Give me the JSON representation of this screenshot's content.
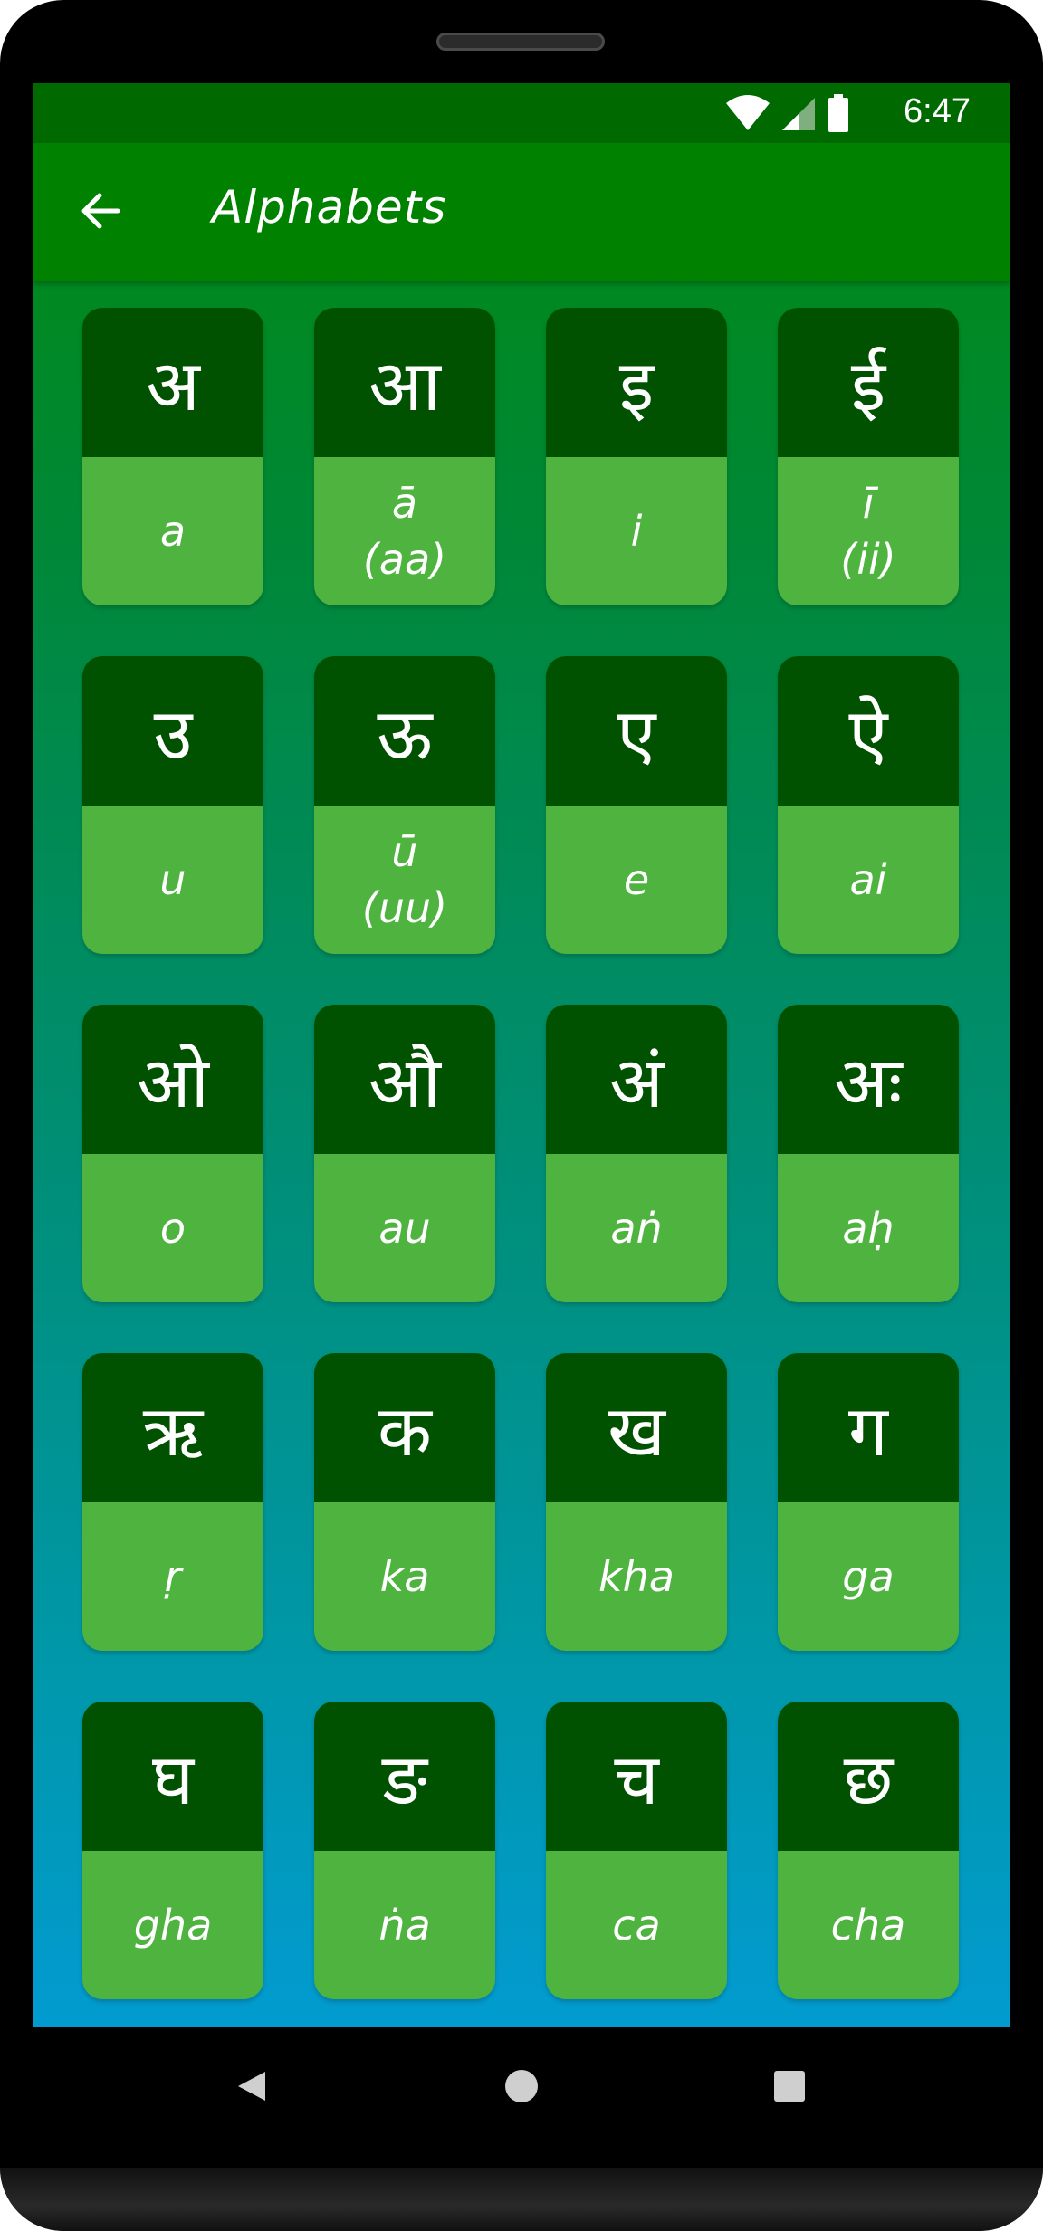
{
  "status_bar": {
    "time": "6:47",
    "icons": [
      "wifi-icon",
      "cell-signal-icon",
      "battery-icon"
    ]
  },
  "app_bar": {
    "title": "Alphabets",
    "back_icon": "arrow-left-icon"
  },
  "colors": {
    "status_bar": "#006a00",
    "app_bar": "#008200",
    "card_top": "#005200",
    "card_bottom": "#4fb43f"
  },
  "letters": [
    {
      "char": "अ",
      "translit": "a"
    },
    {
      "char": "आ",
      "translit": "ā\n(aa)"
    },
    {
      "char": "इ",
      "translit": "i"
    },
    {
      "char": "ई",
      "translit": "ī\n(ii)"
    },
    {
      "char": "उ",
      "translit": "u"
    },
    {
      "char": "ऊ",
      "translit": "ū\n(uu)"
    },
    {
      "char": "ए",
      "translit": "e"
    },
    {
      "char": "ऐ",
      "translit": "ai"
    },
    {
      "char": "ओ",
      "translit": "o"
    },
    {
      "char": "औ",
      "translit": "au"
    },
    {
      "char": "अं",
      "translit": "aṅ"
    },
    {
      "char": "अः",
      "translit": "aḥ"
    },
    {
      "char": "ऋ",
      "translit": "ṛ"
    },
    {
      "char": "क",
      "translit": "ka"
    },
    {
      "char": "ख",
      "translit": "kha"
    },
    {
      "char": "ग",
      "translit": "ga"
    },
    {
      "char": "घ",
      "translit": "gha"
    },
    {
      "char": "ङ",
      "translit": "ṅa"
    },
    {
      "char": "च",
      "translit": "ca"
    },
    {
      "char": "छ",
      "translit": "cha"
    }
  ],
  "nav_bar": {
    "icons": [
      "nav-back-icon",
      "nav-home-icon",
      "nav-recents-icon"
    ]
  }
}
